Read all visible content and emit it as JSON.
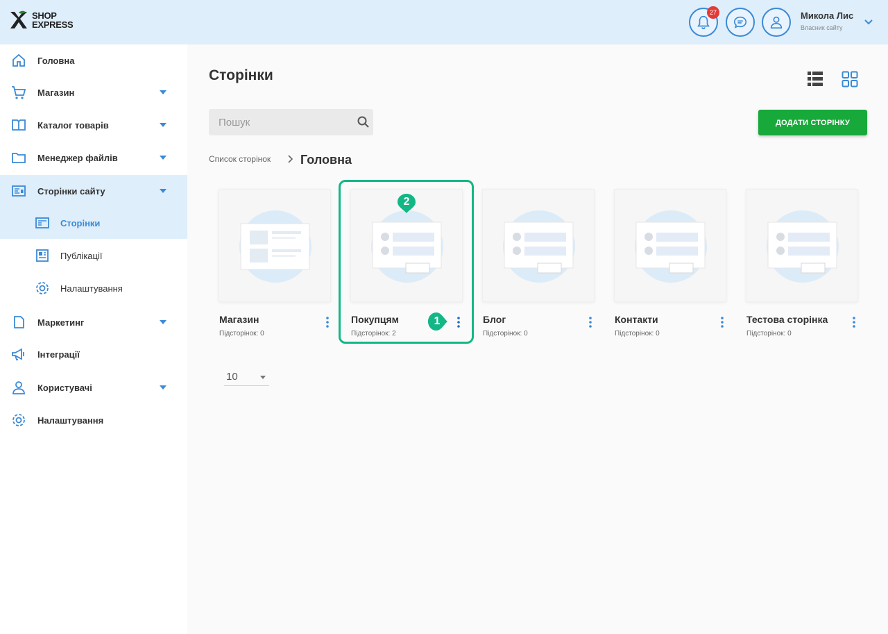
{
  "header": {
    "logo": {
      "line1": "SHOP",
      "line2": "EXPRESS"
    },
    "notification_count": "27",
    "user_name": "Микола Лис",
    "user_role": "Власник сайту"
  },
  "sidebar": {
    "items": [
      {
        "label": "Головна",
        "icon": "home-icon"
      },
      {
        "label": "Магазин",
        "icon": "cart-icon"
      },
      {
        "label": "Каталог товарів",
        "icon": "catalog-icon"
      },
      {
        "label": "Менеджер файлів",
        "icon": "folder-icon"
      },
      {
        "label": "Сторінки сайту",
        "icon": "pages-icon"
      },
      {
        "label": "Маркетинг",
        "icon": "marketing-icon"
      },
      {
        "label": "Інтеграції",
        "icon": "megaphone-icon"
      },
      {
        "label": "Користувачі",
        "icon": "users-icon"
      },
      {
        "label": "Налаштування",
        "icon": "settings-icon"
      }
    ],
    "subitems": [
      {
        "label": "Сторінки",
        "icon": "page-icon"
      },
      {
        "label": "Публікації",
        "icon": "publications-icon"
      },
      {
        "label": "Налаштування",
        "icon": "settings-icon"
      }
    ]
  },
  "main": {
    "title": "Сторінки",
    "search_placeholder": "Пошук",
    "add_button": "ДОДАТИ СТОРІНКУ",
    "breadcrumb": {
      "parent": "Список сторінок",
      "current": "Головна"
    },
    "cards": [
      {
        "title": "Магазин",
        "subtitle": "Підсторінок: 0"
      },
      {
        "title": "Покупцям",
        "subtitle": "Підсторінок: 2"
      },
      {
        "title": "Блог",
        "subtitle": "Підсторінок: 0"
      },
      {
        "title": "Контакти",
        "subtitle": "Підсторінок: 0"
      },
      {
        "title": "Тестова сторінка",
        "subtitle": "Підсторінок: 0"
      }
    ],
    "per_page": "10"
  },
  "annotations": {
    "marker1": "1",
    "marker2": "2"
  },
  "colors": {
    "accent": "#3a8ad6",
    "add_button": "#18a93b",
    "highlight": "#13b786",
    "header_bg": "#deeefb"
  }
}
